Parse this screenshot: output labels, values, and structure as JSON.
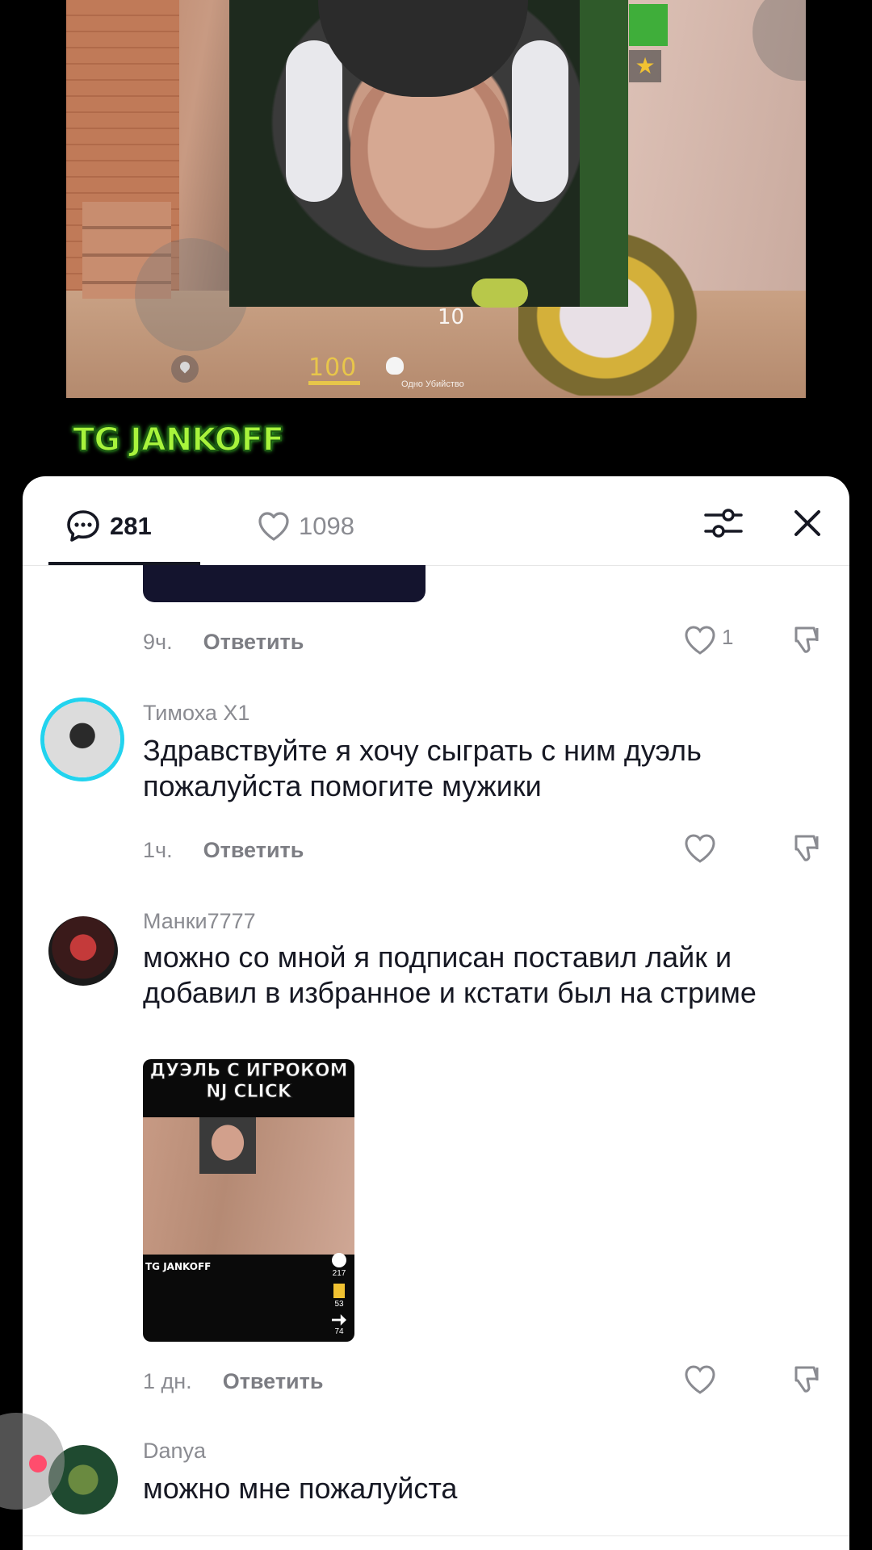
{
  "video": {
    "hud": {
      "health": "100",
      "ammo": "10",
      "killfeed": "Одно Убийство"
    },
    "channel_badge": "TG JANKOFF"
  },
  "comments_panel": {
    "comments_count": "281",
    "likes_count": "1098",
    "icons": {
      "comments": "speech-bubble-icon",
      "likes": "heart-icon",
      "filter": "sliders-icon",
      "close": "close-icon"
    },
    "comments": [
      {
        "time": "9ч.",
        "reply_label": "Ответить",
        "likes": "1",
        "has_image": true
      },
      {
        "username": "Тимоха X1",
        "text": "Здравствуйте я хочу сыграть с ним дуэль пожалуйста помогите мужики",
        "time": "1ч.",
        "reply_label": "Ответить"
      },
      {
        "username": "Манки7777",
        "text": "можно со мной я подписан поставил лайк и добавил в избранное и кстати был на стриме",
        "thumb": {
          "title": "ДУЭЛЬ С ИГРОКОМ NJ CLICK",
          "badge": "TG JANKOFF",
          "comments": "217",
          "saves": "53",
          "shares": "74"
        },
        "time": "1 дн.",
        "reply_label": "Ответить"
      },
      {
        "username": "Danya",
        "text": "можно мне пожалуйста"
      }
    ]
  },
  "colors": {
    "accent_text": "#161823",
    "muted_text": "#8a8b91",
    "badge_green": "#a8f43c",
    "story_ring": "#22d3ee"
  }
}
